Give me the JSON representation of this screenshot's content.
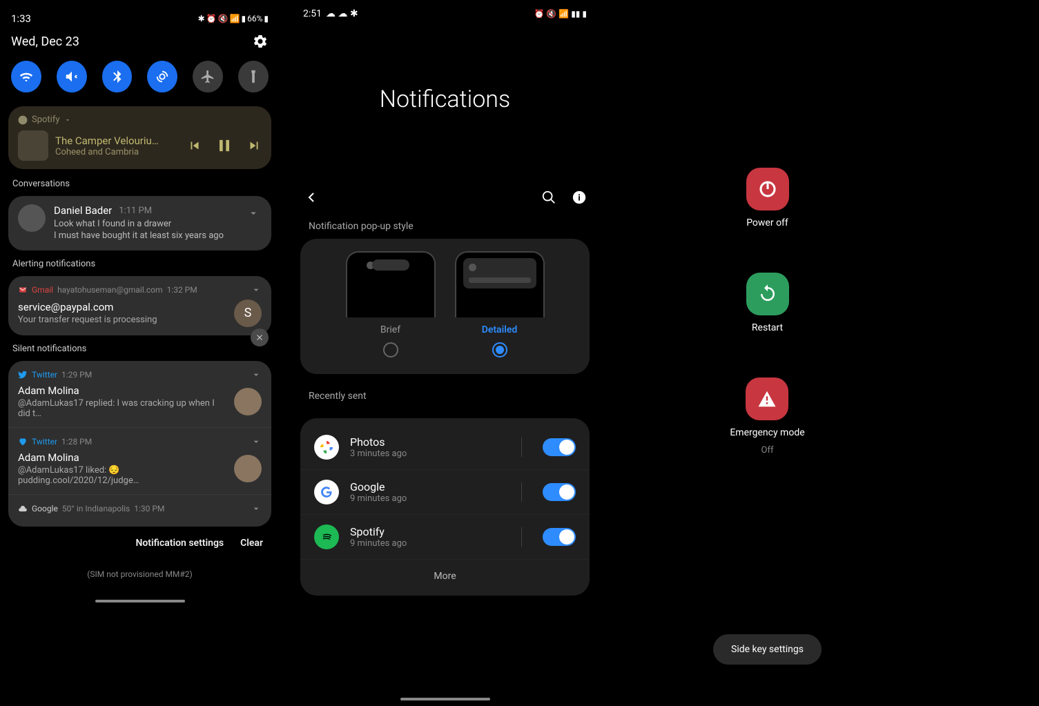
{
  "phone1": {
    "statusbar": {
      "time": "1:33",
      "battery": "66%"
    },
    "date": "Wed, Dec 23",
    "quickSettings": [
      "wifi",
      "mute",
      "bluetooth",
      "rotate",
      "airplane",
      "flashlight"
    ],
    "media": {
      "app": "Spotify",
      "track": "The Camper Velouriu…",
      "artist": "Coheed and Cambria"
    },
    "sections": {
      "conversations": "Conversations",
      "alerting": "Alerting notifications",
      "silent": "Silent notifications"
    },
    "convo": {
      "name": "Daniel Bader",
      "time": "1:11 PM",
      "line1": "Look what I found in a drawer",
      "line2": "I must have bought it at least six years ago"
    },
    "gmail": {
      "app": "Gmail",
      "account": "hayatohuseman@gmail.com",
      "time": "1:32 PM",
      "title": "service@paypal.com",
      "body": "Your transfer request is processing",
      "avatarLetter": "S"
    },
    "silent": [
      {
        "app": "Twitter",
        "time": "1:29 PM",
        "title": "Adam Molina",
        "body": "@AdamLukas17 replied: I was cracking up when I did t…"
      },
      {
        "app": "Twitter",
        "time": "1:28 PM",
        "title": "Adam Molina",
        "body": "@AdamLukas17 liked: 😔 pudding.cool/2020/12/judge…"
      }
    ],
    "google": {
      "app": "Google",
      "text": "50° in Indianapolis",
      "time": "1:30 PM"
    },
    "actions": {
      "settings": "Notification settings",
      "clear": "Clear"
    },
    "sim": "(SIM not provisioned MM#2)"
  },
  "phone2": {
    "statusbar": {
      "time": "2:51"
    },
    "title": "Notifications",
    "popupLabel": "Notification pop-up style",
    "styles": {
      "brief": "Brief",
      "detailed": "Detailed"
    },
    "recentLabel": "Recently sent",
    "recent": [
      {
        "name": "Photos",
        "time": "3 minutes ago"
      },
      {
        "name": "Google",
        "time": "9 minutes ago"
      },
      {
        "name": "Spotify",
        "time": "9 minutes ago"
      }
    ],
    "more": "More"
  },
  "phone3": {
    "powerOff": "Power off",
    "restart": "Restart",
    "emergency": "Emergency mode",
    "emergencySub": "Off",
    "sideKey": "Side key settings"
  }
}
